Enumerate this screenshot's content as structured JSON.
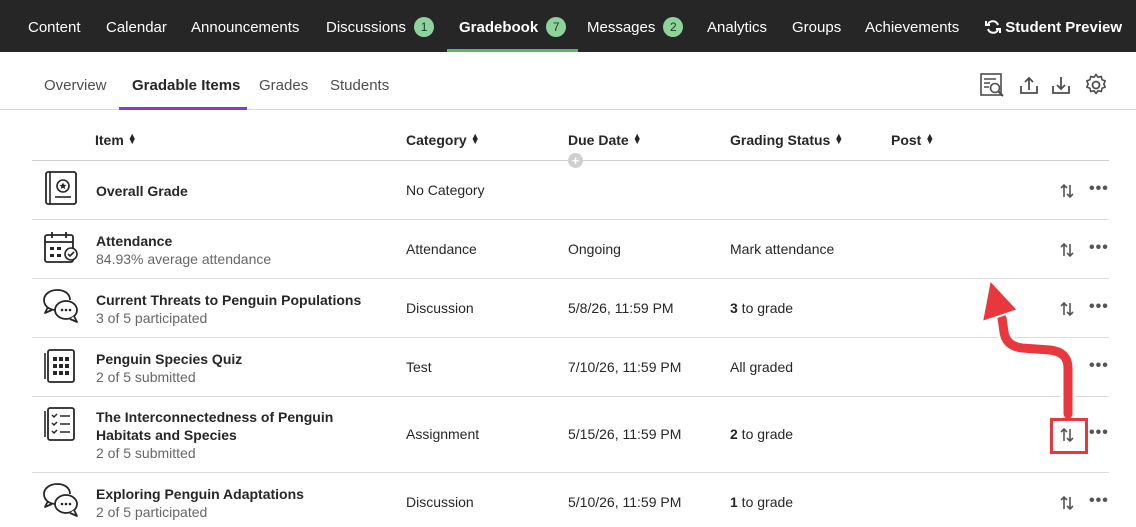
{
  "topnav": {
    "items": [
      {
        "label": "Content"
      },
      {
        "label": "Calendar"
      },
      {
        "label": "Announcements"
      },
      {
        "label": "Discussions",
        "badge": "1"
      },
      {
        "label": "Gradebook",
        "badge": "7"
      },
      {
        "label": "Messages",
        "badge": "2"
      },
      {
        "label": "Analytics"
      },
      {
        "label": "Groups"
      },
      {
        "label": "Achievements"
      }
    ],
    "active": "Gradebook",
    "student_preview": "Student Preview"
  },
  "subtabs": {
    "items": [
      "Overview",
      "Gradable Items",
      "Grades",
      "Students"
    ],
    "active": "Gradable Items"
  },
  "table": {
    "headers": [
      "Item",
      "Category",
      "Due Date",
      "Grading Status",
      "Post"
    ],
    "rows": [
      {
        "title": "Overall Grade",
        "subtitle": "",
        "category": "No Category",
        "due": "",
        "status_num": "",
        "status_text": "",
        "icon": "gradebook-icon"
      },
      {
        "title": "Attendance",
        "subtitle": "84.93% average attendance",
        "category": "Attendance",
        "due": "Ongoing",
        "status_num": "",
        "status_text": "Mark attendance",
        "icon": "calendar-check-icon"
      },
      {
        "title": "Current Threats to Penguin Populations",
        "subtitle": "3 of 5 participated",
        "category": "Discussion",
        "due": "5/8/26, 11:59 PM",
        "status_num": "3",
        "status_text": " to grade",
        "icon": "discussion-icon"
      },
      {
        "title": "Penguin Species Quiz",
        "subtitle": "2 of 5 submitted",
        "category": "Test",
        "due": "7/10/26, 11:59 PM",
        "status_num": "",
        "status_text": "All graded",
        "icon": "test-icon"
      },
      {
        "title": "The Interconnectedness of Penguin Habitats and Species",
        "subtitle": "2 of 5 submitted",
        "category": "Assignment",
        "due": "5/15/26, 11:59 PM",
        "status_num": "2",
        "status_text": " to grade",
        "icon": "assignment-icon"
      },
      {
        "title": "Exploring Penguin Adaptations",
        "subtitle": "2 of 5 participated",
        "category": "Discussion",
        "due": "5/10/26, 11:59 PM",
        "status_num": "1",
        "status_text": " to grade",
        "icon": "discussion-icon"
      }
    ]
  },
  "colors": {
    "nav_bg": "#262626",
    "badge": "#8ed39c",
    "active_tab_underline": "#57b76b",
    "subtab_underline": "#8a3ac4",
    "annotation": "#e8383d"
  }
}
